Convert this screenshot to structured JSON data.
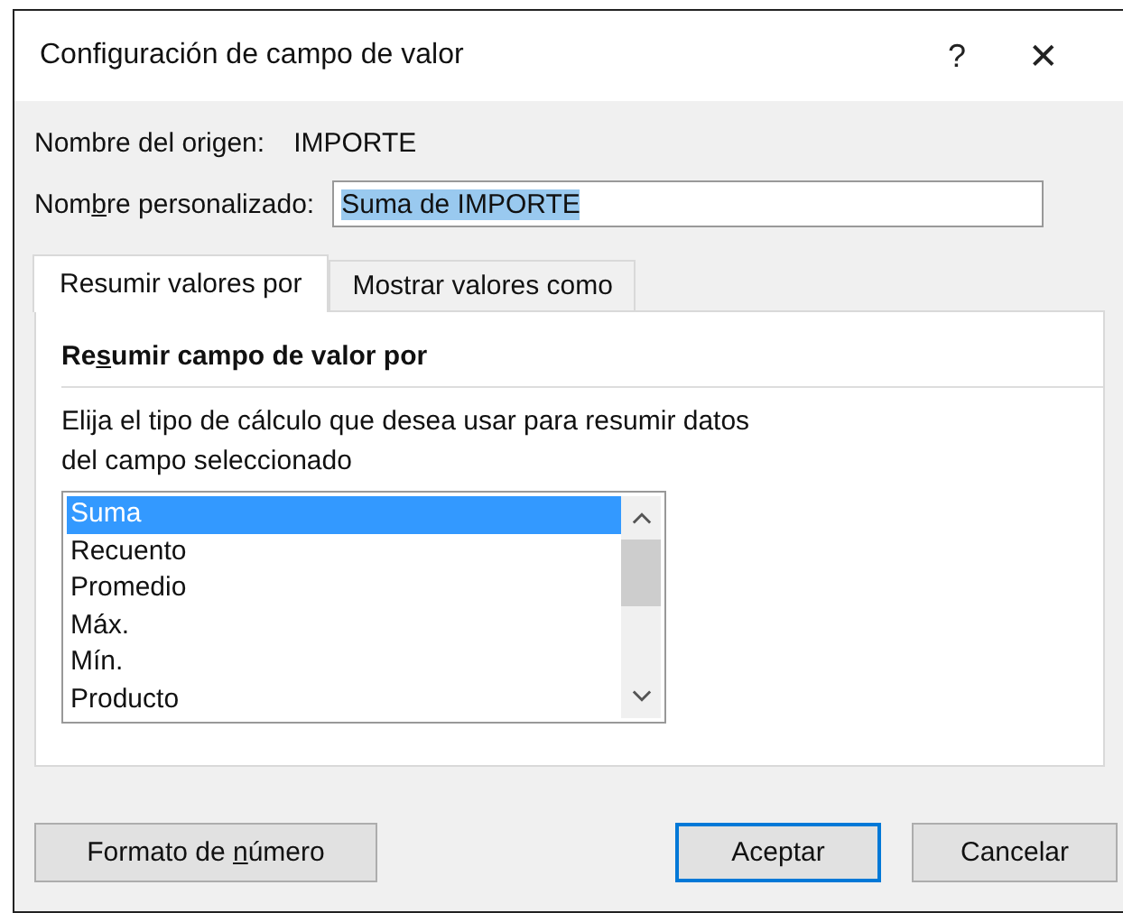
{
  "window": {
    "title": "Configuración de campo de valor",
    "help": "?",
    "close": "✕"
  },
  "source_name": {
    "label": "Nombre del origen:",
    "value": "IMPORTE"
  },
  "custom_name": {
    "label": {
      "pre": "Nom",
      "key": "b",
      "post": "re personalizado:"
    },
    "value": "Suma de IMPORTE",
    "value_selected": true
  },
  "tabs": [
    {
      "label": "Resumir valores por",
      "selected": true
    },
    {
      "label": "Mostrar valores como",
      "selected": false
    }
  ],
  "section": {
    "heading": {
      "pre": "Re",
      "key": "s",
      "post": "umir campo de valor por"
    },
    "description": "Elija el tipo de cálculo que desea usar para resumir datos del campo seleccionado"
  },
  "list": [
    {
      "label": "Suma",
      "selected": true
    },
    {
      "label": "Recuento",
      "selected": false
    },
    {
      "label": "Promedio",
      "selected": false
    },
    {
      "label": "Máx.",
      "selected": false
    },
    {
      "label": "Mín.",
      "selected": false
    },
    {
      "label": "Producto",
      "selected": false
    }
  ],
  "buttons": [
    {
      "kind": "format",
      "label": {
        "pre": "Formato de ",
        "key": "n",
        "post": "úmero"
      },
      "default": false
    },
    {
      "kind": "ok",
      "label": "Aceptar",
      "default": true
    },
    {
      "kind": "cancel",
      "label": "Cancelar",
      "default": false
    }
  ]
}
